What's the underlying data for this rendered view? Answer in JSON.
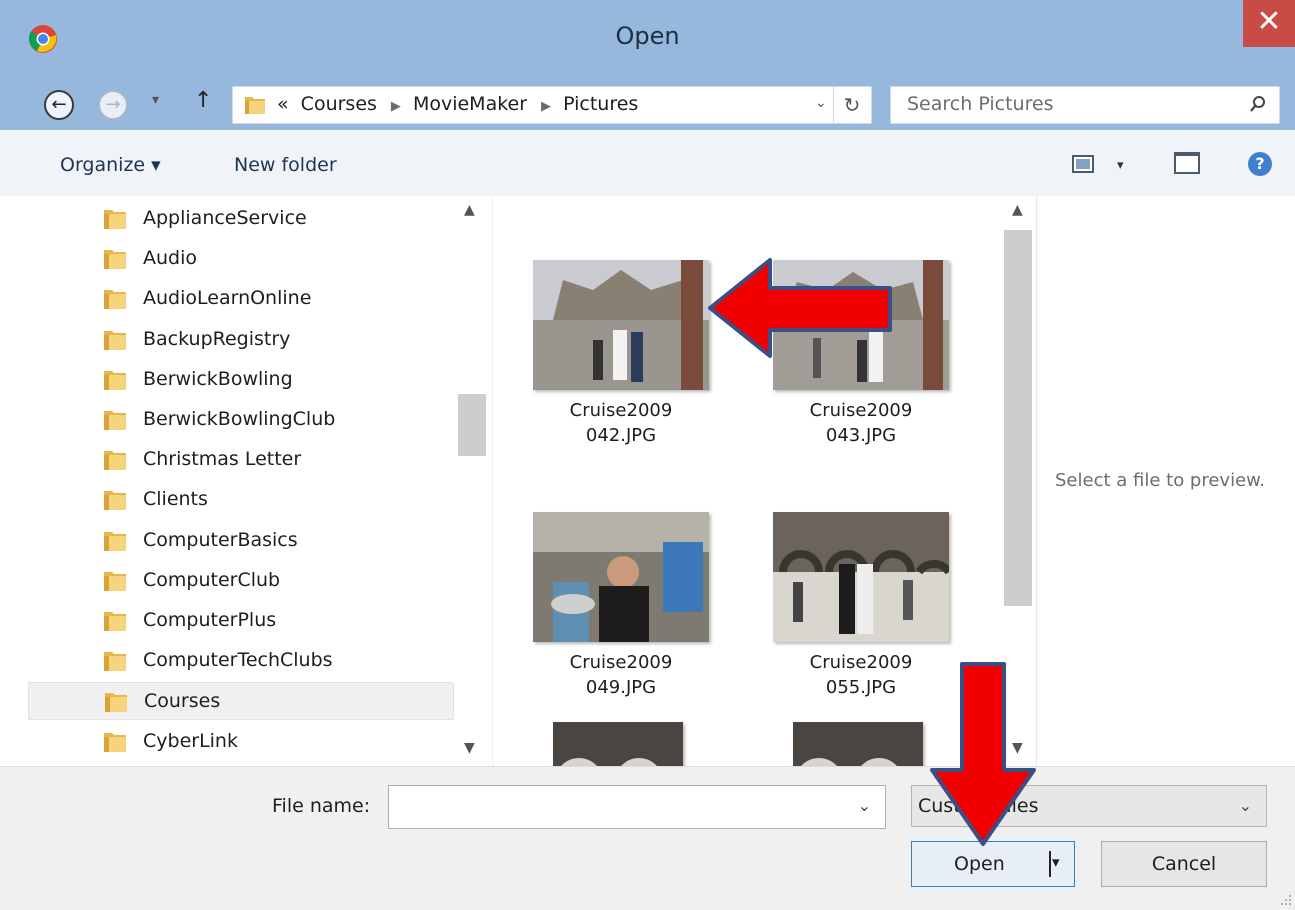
{
  "window": {
    "title": "Open",
    "close_glyph": "✕"
  },
  "nav": {
    "back_glyph": "←",
    "forward_glyph": "→",
    "recent_glyph": "▾",
    "up_glyph": "↑"
  },
  "address": {
    "crumbs": [
      "«",
      "Courses",
      "MovieMaker",
      "Pictures"
    ],
    "dropdown_glyph": "⌄",
    "refresh_glyph": "↻"
  },
  "search": {
    "placeholder": "Search Pictures"
  },
  "toolbar": {
    "organize_label": "Organize ▾",
    "new_folder_label": "New folder",
    "view_arrow": "▾",
    "help_glyph": "?"
  },
  "folders": [
    {
      "label": "ApplianceService"
    },
    {
      "label": "Audio"
    },
    {
      "label": "AudioLearnOnline"
    },
    {
      "label": "BackupRegistry"
    },
    {
      "label": "BerwickBowling"
    },
    {
      "label": "BerwickBowlingClub"
    },
    {
      "label": "Christmas Letter"
    },
    {
      "label": "Clients"
    },
    {
      "label": "ComputerBasics"
    },
    {
      "label": "ComputerClub"
    },
    {
      "label": "ComputerPlus"
    },
    {
      "label": "ComputerTechClubs"
    },
    {
      "label": "Courses",
      "selected": true
    },
    {
      "label": "CyberLink"
    }
  ],
  "files": [
    {
      "name_line1": "Cruise2009",
      "name_line2": "042.JPG"
    },
    {
      "name_line1": "Cruise2009",
      "name_line2": "043.JPG"
    },
    {
      "name_line1": "Cruise2009",
      "name_line2": "049.JPG"
    },
    {
      "name_line1": "Cruise2009",
      "name_line2": "055.JPG"
    }
  ],
  "scroll_glyphs": {
    "up": "▲",
    "down": "▼"
  },
  "preview": {
    "empty_text": "Select a file to preview."
  },
  "bottom": {
    "file_name_label": "File name:",
    "file_name_value": "",
    "file_type_text": "Custom Files",
    "dropdown_glyph": "⌄",
    "open_label": "Open",
    "open_split_glyph": "▾",
    "cancel_label": "Cancel"
  },
  "colors": {
    "annotation_arrow": "#f20000",
    "annotation_outline": "#3b4f87",
    "title_bar": "#96b8dc",
    "close_button": "#c84b45"
  },
  "icons": [
    "chrome-app-icon",
    "folder-icon",
    "search-icon",
    "view-icon",
    "preview-pane-icon",
    "help-icon"
  ]
}
